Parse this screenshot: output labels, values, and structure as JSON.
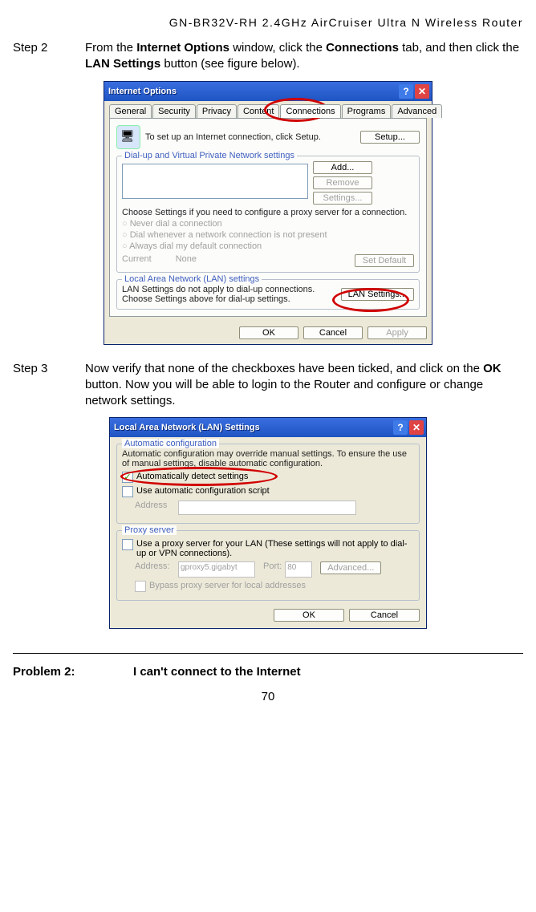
{
  "header": "GN-BR32V-RH 2.4GHz AirCruiser Ultra N Wireless Router",
  "step2": {
    "label": "Step 2",
    "text_before": "From the ",
    "bold1": "Internet Options",
    "text_mid1": " window, click the ",
    "bold2": "Connections",
    "text_mid2": " tab, and then click the ",
    "bold3": "LAN Settings",
    "text_after": " button (see figure below)."
  },
  "win1": {
    "title": "Internet Options",
    "tabs": [
      "General",
      "Security",
      "Privacy",
      "Content",
      "Connections",
      "Programs",
      "Advanced"
    ],
    "setup_text": "To set up an Internet connection, click Setup.",
    "btn_setup": "Setup...",
    "grp_dial": "Dial-up and Virtual Private Network settings",
    "btn_add": "Add...",
    "btn_remove": "Remove",
    "btn_settings": "Settings...",
    "proxy_text": "Choose Settings if you need to configure a proxy server for a connection.",
    "r1": "Never dial a connection",
    "r2": "Dial whenever a network connection is not present",
    "r3": "Always dial my default connection",
    "current": "Current",
    "none": "None",
    "btn_default": "Set Default",
    "grp_lan": "Local Area Network (LAN) settings",
    "lan_text": "LAN Settings do not apply to dial-up connections. Choose Settings above for dial-up settings.",
    "btn_lan": "LAN Settings...",
    "ok": "OK",
    "cancel": "Cancel",
    "apply": "Apply"
  },
  "step3": {
    "label": "Step 3",
    "text_before": "Now verify that none of the checkboxes have been ticked, and click on the ",
    "bold1": "OK",
    "text_after": " button.    Now you will be able to login to the Router and configure or change network settings."
  },
  "win2": {
    "title": "Local Area Network (LAN) Settings",
    "grp_auto": "Automatic configuration",
    "auto_text": "Automatic configuration may override manual settings.  To ensure the use of manual settings, disable automatic configuration.",
    "chk_auto": "Automatically detect settings",
    "chk_script": "Use automatic configuration script",
    "address": "Address",
    "grp_proxy": "Proxy server",
    "proxy_chk": "Use a proxy server for your LAN (These settings will not apply to dial-up or VPN connections).",
    "addr2": "Address:",
    "addr_val": "gproxy5.gigabyt",
    "port": "Port:",
    "port_val": "80",
    "advanced": "Advanced...",
    "bypass": "Bypass proxy server for local addresses",
    "ok": "OK",
    "cancel": "Cancel"
  },
  "problem": {
    "label": "Problem 2:",
    "text": "I can't connect to the Internet"
  },
  "page_no": "70"
}
